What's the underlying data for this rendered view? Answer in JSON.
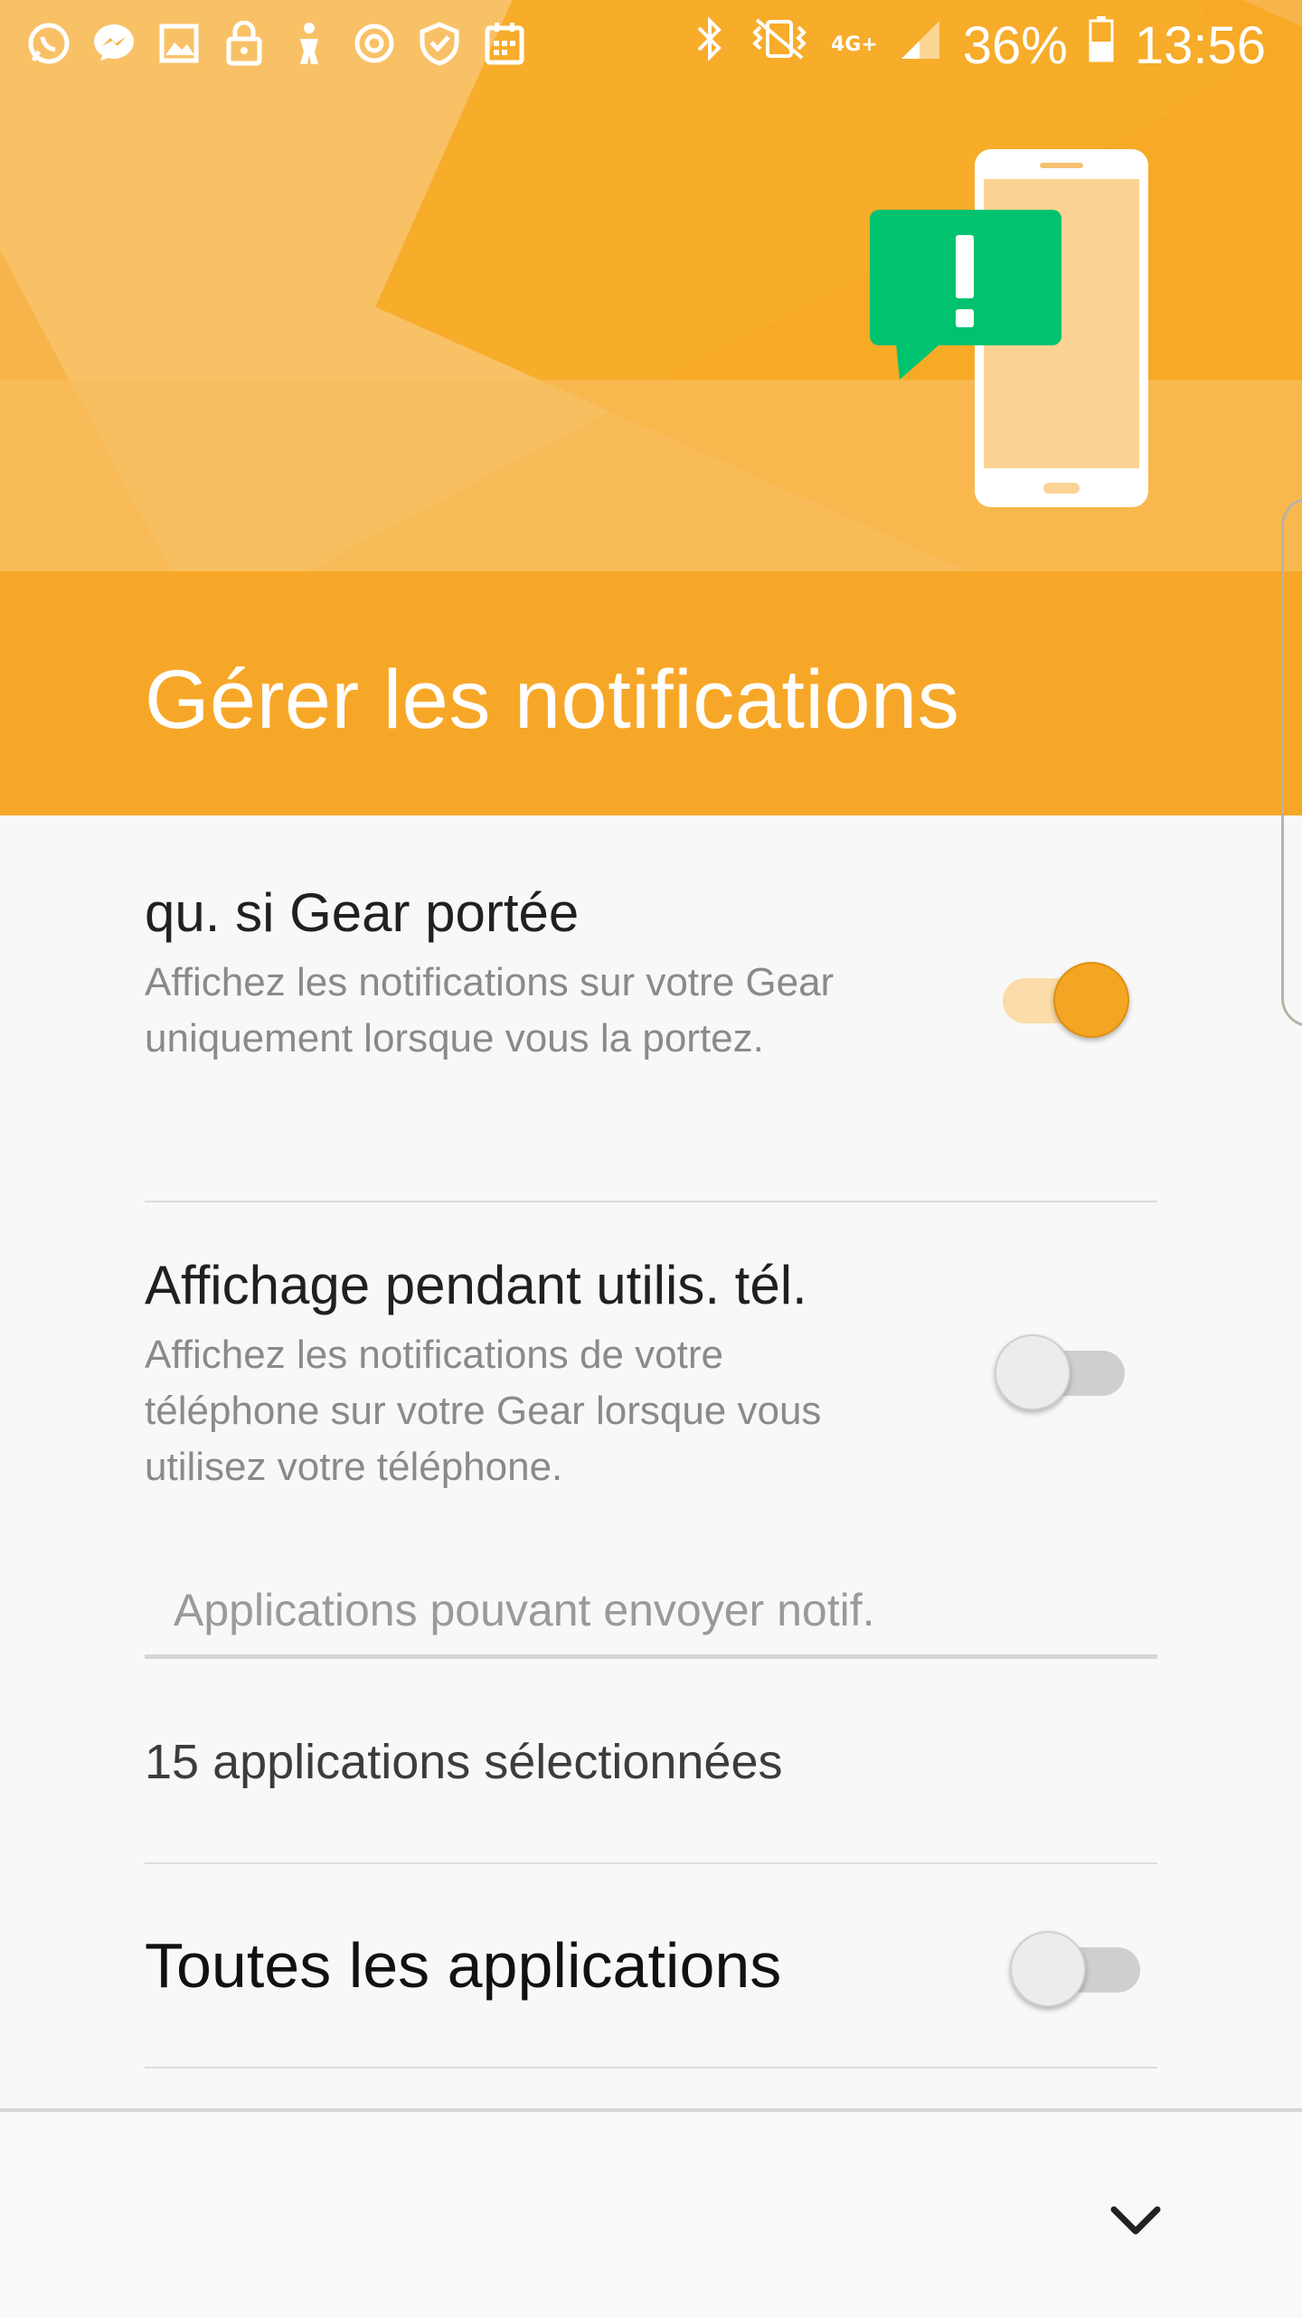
{
  "status_bar": {
    "battery_text": "36%",
    "time": "13:56",
    "network": "4G+",
    "left_icons": [
      "whatsapp-icon",
      "messenger-icon",
      "gallery-icon",
      "lock-icon",
      "accessibility-icon",
      "sync-icon",
      "shield-icon",
      "calendar-icon"
    ],
    "right_icons": [
      "bluetooth-icon",
      "vibrate-mute-icon",
      "signal-icon",
      "battery-icon"
    ]
  },
  "header": {
    "title": "Gérer les notifications"
  },
  "settings": {
    "wear_only": {
      "title": "qu. si Gear portée",
      "description": "Affichez les notifications sur votre Gear uniquement lorsque vous la portez.",
      "enabled": true
    },
    "phone_in_use": {
      "title": "Affichage pendant utilis. tél.",
      "description": "Affichez les notifications de votre téléphone sur votre Gear lorsque vous utilisez votre téléphone.",
      "enabled": false
    }
  },
  "apps_section": {
    "search_placeholder": "Applications pouvant envoyer notif.",
    "selected_count": "15 applications sélectionnées",
    "all_apps_label": "Toutes les applications",
    "all_apps_enabled": false
  },
  "colors": {
    "accent": "#f7a728",
    "switch_on": "#f5a524",
    "icon_green": "#00c26f"
  },
  "bottom_bar": {
    "icon": "chevron-down-icon"
  }
}
